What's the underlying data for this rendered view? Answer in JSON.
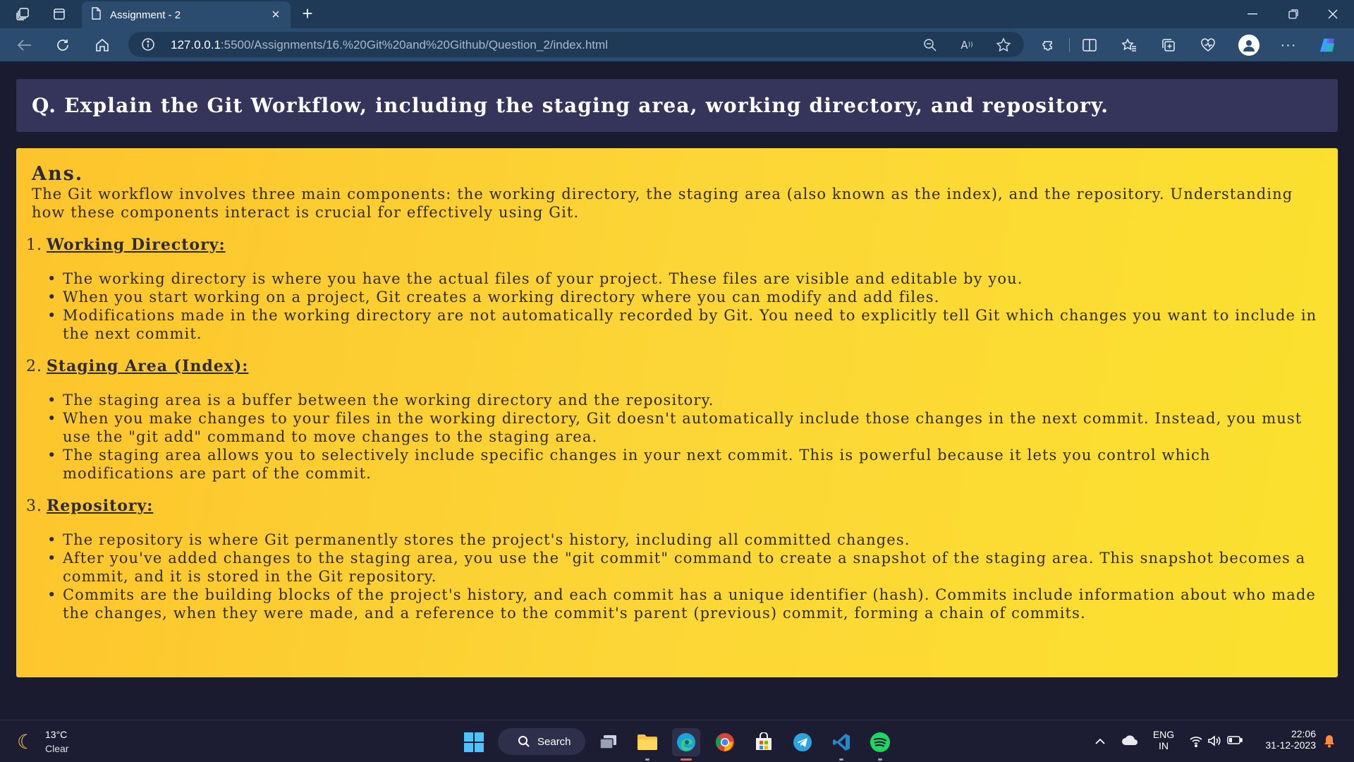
{
  "browser": {
    "tab_title": "Assignment - 2",
    "url_host": "127.0.0.1",
    "url_path": ":5500/Assignments/16.%20Git%20and%20Github/Question_2/index.html"
  },
  "page": {
    "question": "Q. Explain the Git Workflow, including the staging area, working directory, and repository.",
    "ans_label": "Ans.",
    "intro": "The Git workflow involves three main components: the working directory, the staging area (also known as the index), and the repository. Understanding how these components interact is crucial for effectively using Git.",
    "sections": [
      {
        "num": "1.",
        "title": "Working Directory:",
        "points": [
          "The working directory is where you have the actual files of your project. These files are visible and editable by you.",
          "When you start working on a project, Git creates a working directory where you can modify and add files.",
          "Modifications made in the working directory are not automatically recorded by Git. You need to explicitly tell Git which changes you want to include in the next commit."
        ]
      },
      {
        "num": "2.",
        "title": "Staging Area (Index):",
        "points": [
          "The staging area is a buffer between the working directory and the repository.",
          "When you make changes to your files in the working directory, Git doesn't automatically include those changes in the next commit. Instead, you must use the \"git add\" command to move changes to the staging area.",
          "The staging area allows you to selectively include specific changes in your next commit. This is powerful because it lets you control which modifications are part of the commit."
        ]
      },
      {
        "num": "3.",
        "title": "Repository:",
        "points": [
          "The repository is where Git permanently stores the project's history, including all committed changes.",
          "After you've added changes to the staging area, you use the \"git commit\" command to create a snapshot of the staging area. This snapshot becomes a commit, and it is stored in the Git repository.",
          "Commits are the building blocks of the project's history, and each commit has a unique identifier (hash). Commits include information about who made the changes, when they were made, and a reference to the commit's parent (previous) commit, forming a chain of commits."
        ]
      }
    ]
  },
  "taskbar": {
    "temperature": "13°C",
    "condition": "Clear",
    "search_label": "Search",
    "lang_line1": "ENG",
    "lang_line2": "IN",
    "time": "22:06",
    "date": "31-12-2023"
  },
  "colors": {
    "question_bg": "#35345a",
    "answer_bg_start": "#fdc42b",
    "answer_bg_end": "#fbe12e",
    "page_bg": "#1b1b2f"
  }
}
